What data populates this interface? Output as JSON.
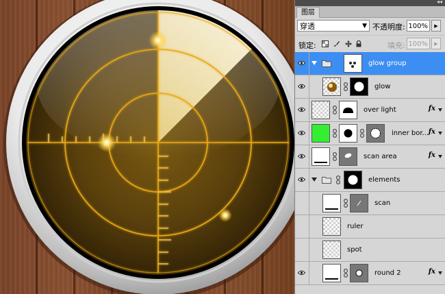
{
  "panel": {
    "tab_title": "图层",
    "collapse_glyph": "◂◂",
    "blend_mode": "穿透",
    "opacity_label": "不透明度:",
    "opacity_value": "100%",
    "lock_label": "锁定:",
    "fill_label": "填充:",
    "fill_value": "100%"
  },
  "layers": [
    {
      "name": "glow group",
      "type": "group",
      "selected": true,
      "visible": true
    },
    {
      "name": "glow",
      "type": "layer",
      "indented": true,
      "visible": true
    },
    {
      "name": "over light",
      "type": "layer",
      "fx": "fx",
      "visible": true
    },
    {
      "name": "inner bor...",
      "type": "layer",
      "fx": "fx",
      "visible": true
    },
    {
      "name": "scan area",
      "type": "layer",
      "fx": "fx",
      "visible": true
    },
    {
      "name": "elements",
      "type": "group",
      "visible": true
    },
    {
      "name": "scan",
      "type": "layer",
      "indented": true,
      "visible": false
    },
    {
      "name": "ruler",
      "type": "layer",
      "indented": true,
      "visible": false
    },
    {
      "name": "spot",
      "type": "layer",
      "indented": true,
      "visible": false
    },
    {
      "name": "round 2",
      "type": "layer",
      "indented": true,
      "fx": "fx",
      "visible": true
    }
  ],
  "colors": {
    "selection": "#3d8ef2",
    "panel_bg": "#d6d6d6",
    "radar_glow": "#ffc21a",
    "wood": "#7a4429",
    "green_thumb": "#33ee33"
  },
  "icons": [
    "eye-icon",
    "folder-icon",
    "chain-link-icon",
    "lock-transparent-icon",
    "lock-brush-icon",
    "lock-move-icon",
    "lock-all-icon",
    "fx-icon"
  ]
}
